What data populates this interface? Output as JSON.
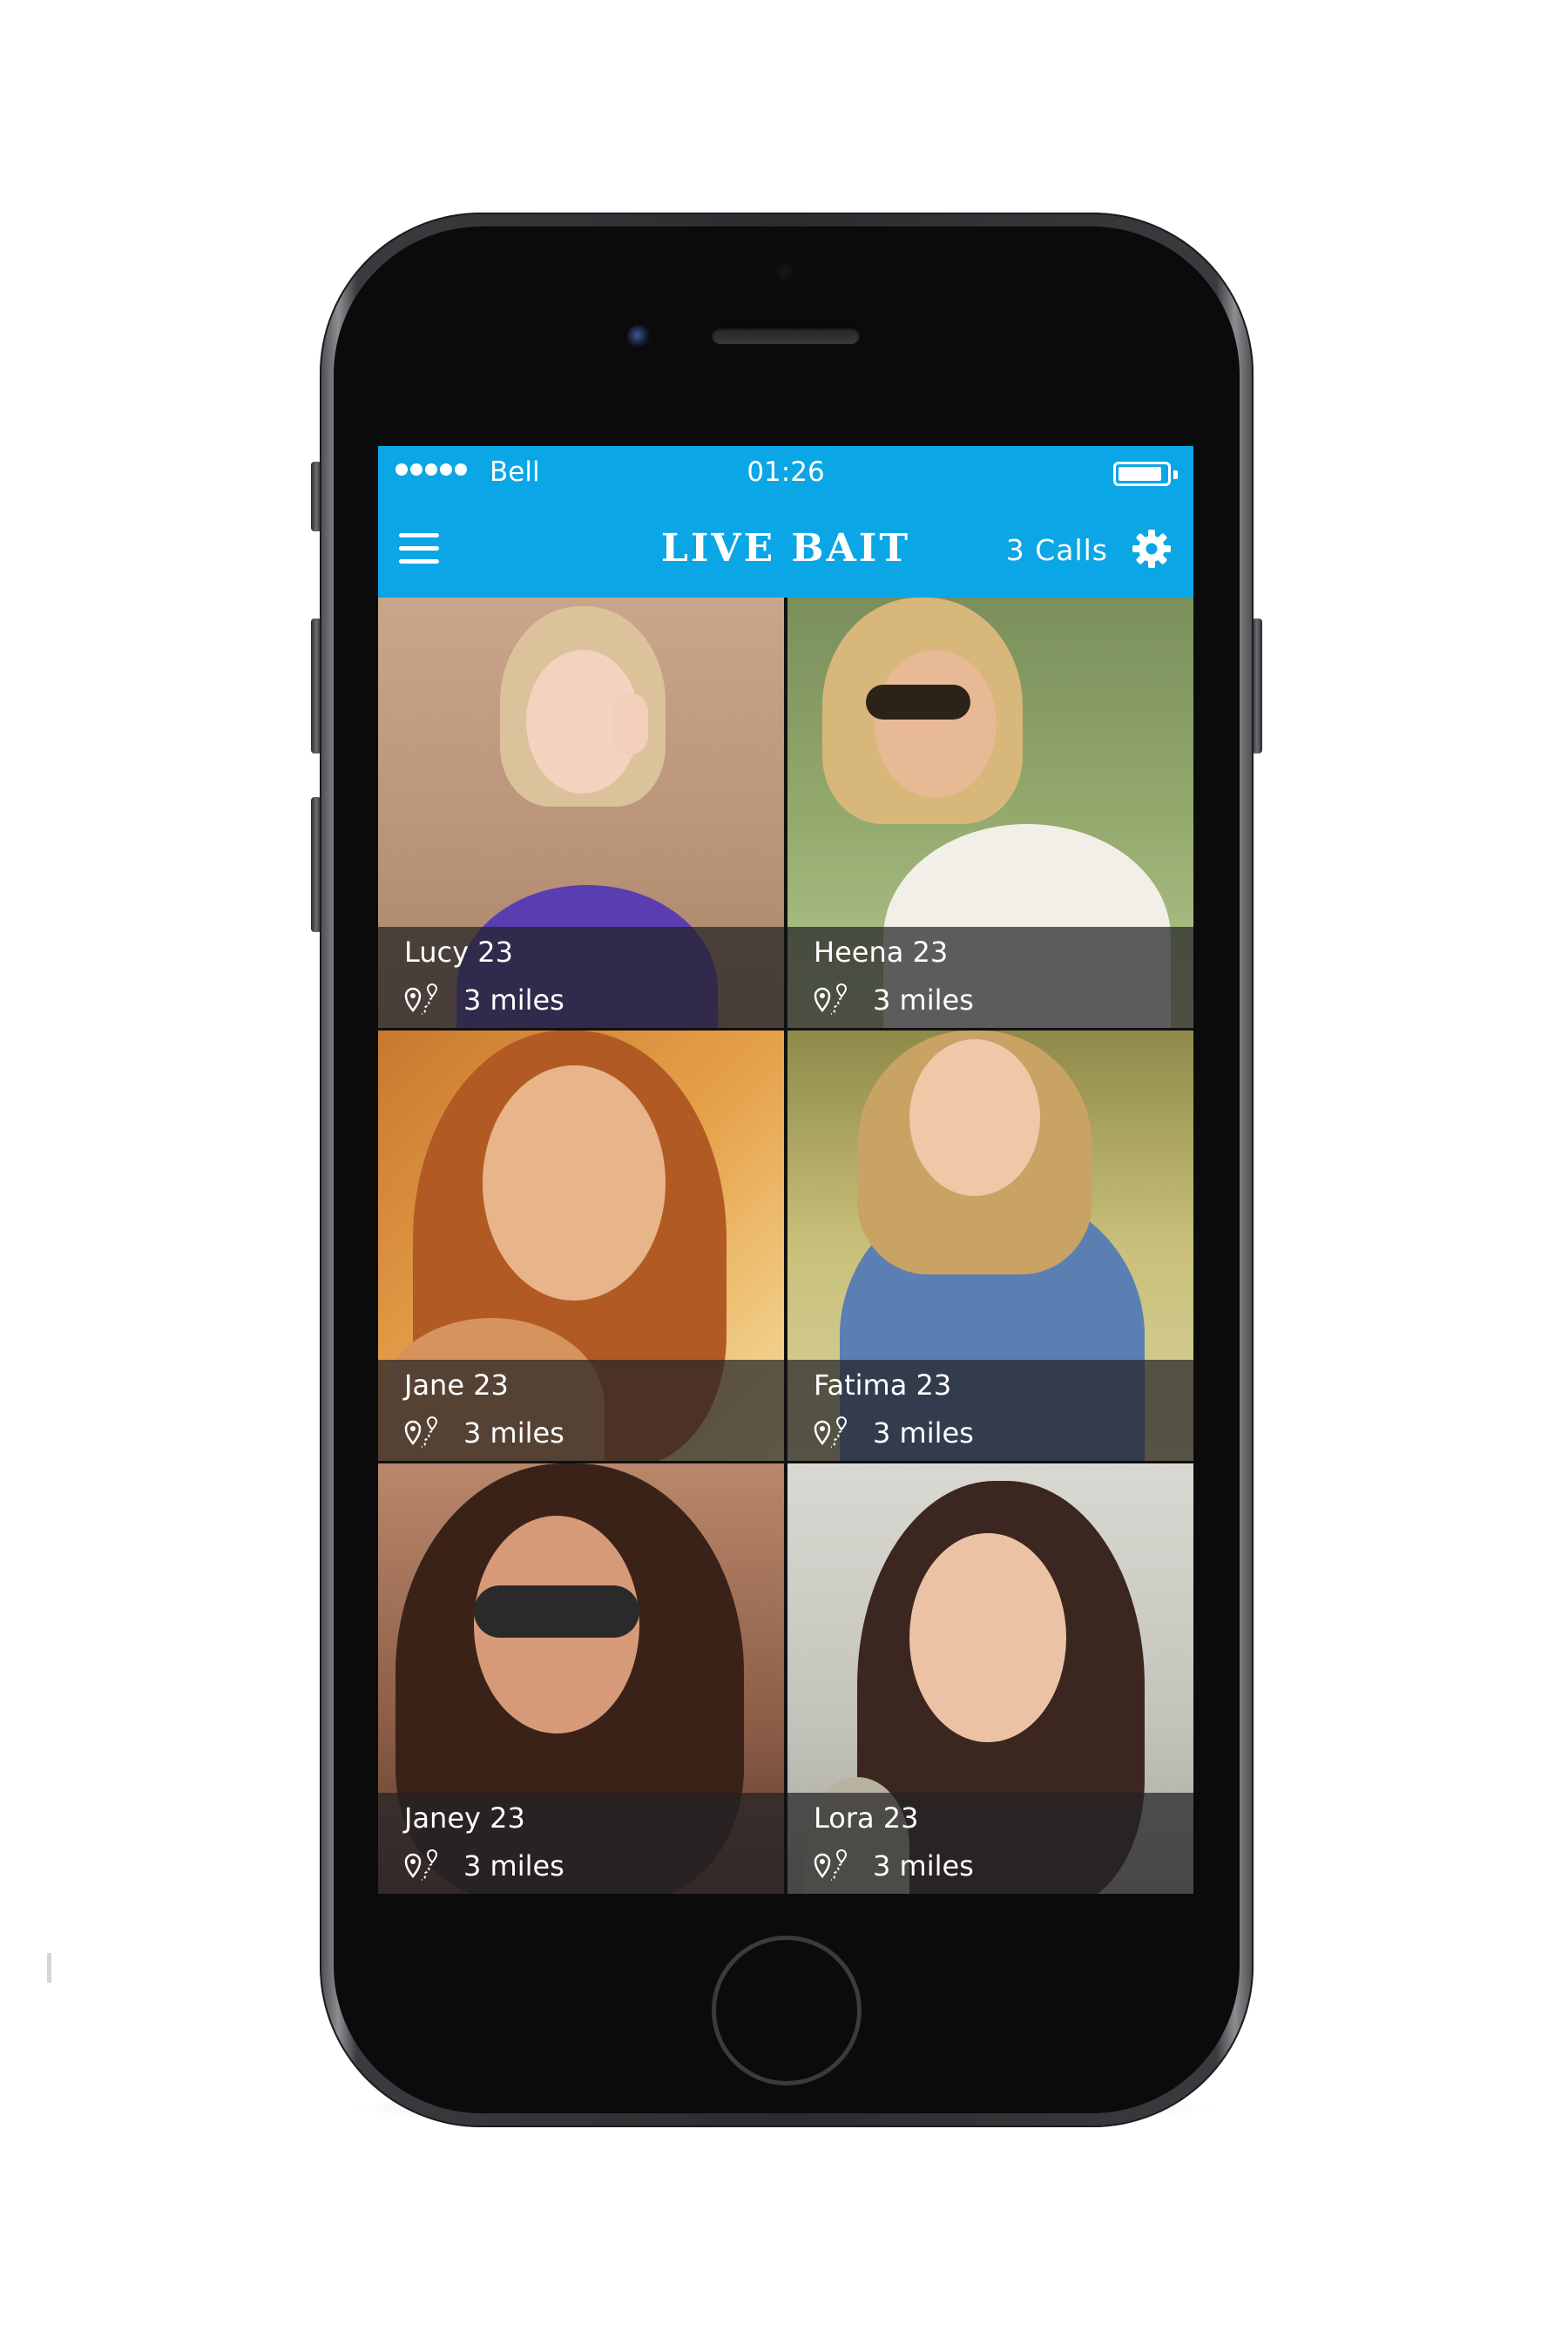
{
  "status_bar": {
    "carrier": "Bell",
    "time": "01:26",
    "signal_dots": 5,
    "battery_level": 0.9
  },
  "header": {
    "title": "LIVE BAIT",
    "calls_label": "3 Calls",
    "menu_icon": "hamburger-menu-icon",
    "settings_icon": "gear-icon"
  },
  "profiles": [
    {
      "name": "Lucy 23",
      "distance": "3 miles"
    },
    {
      "name": "Heena 23",
      "distance": "3 miles"
    },
    {
      "name": "Jane 23",
      "distance": "3 miles"
    },
    {
      "name": "Fatima 23",
      "distance": "3 miles"
    },
    {
      "name": "Janey 23",
      "distance": "3 miles"
    },
    {
      "name": "Lora 23",
      "distance": "3 miles"
    }
  ],
  "colors": {
    "accent": "#0ba6e5",
    "caption_overlay": "#232326",
    "device": "#2b2c2f"
  }
}
